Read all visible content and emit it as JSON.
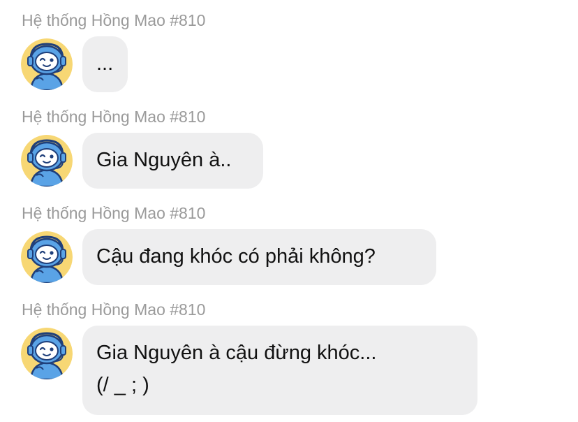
{
  "conversation": {
    "messages": [
      {
        "sender": "Hệ thống Hồng Mao #810",
        "text": "..."
      },
      {
        "sender": "Hệ thống Hồng Mao #810",
        "text": "Gia Nguyên à.."
      },
      {
        "sender": "Hệ thống Hồng Mao #810",
        "text": "Cậu đang khóc có phải không?"
      },
      {
        "sender": "Hệ thống Hồng Mao #810",
        "text": "Gia Nguyên à cậu đừng khóc...\n(/ _ ; )"
      }
    ]
  },
  "avatar": {
    "icon": "robot-mascot-icon",
    "colors": {
      "background": "#f7d774",
      "body": "#5aa3e6",
      "outline": "#1f3f7a",
      "face": "#ffffff"
    }
  },
  "colors": {
    "bubble": "#eeeeef",
    "sender_label": "#9a9a9a",
    "message_text": "#111111"
  }
}
